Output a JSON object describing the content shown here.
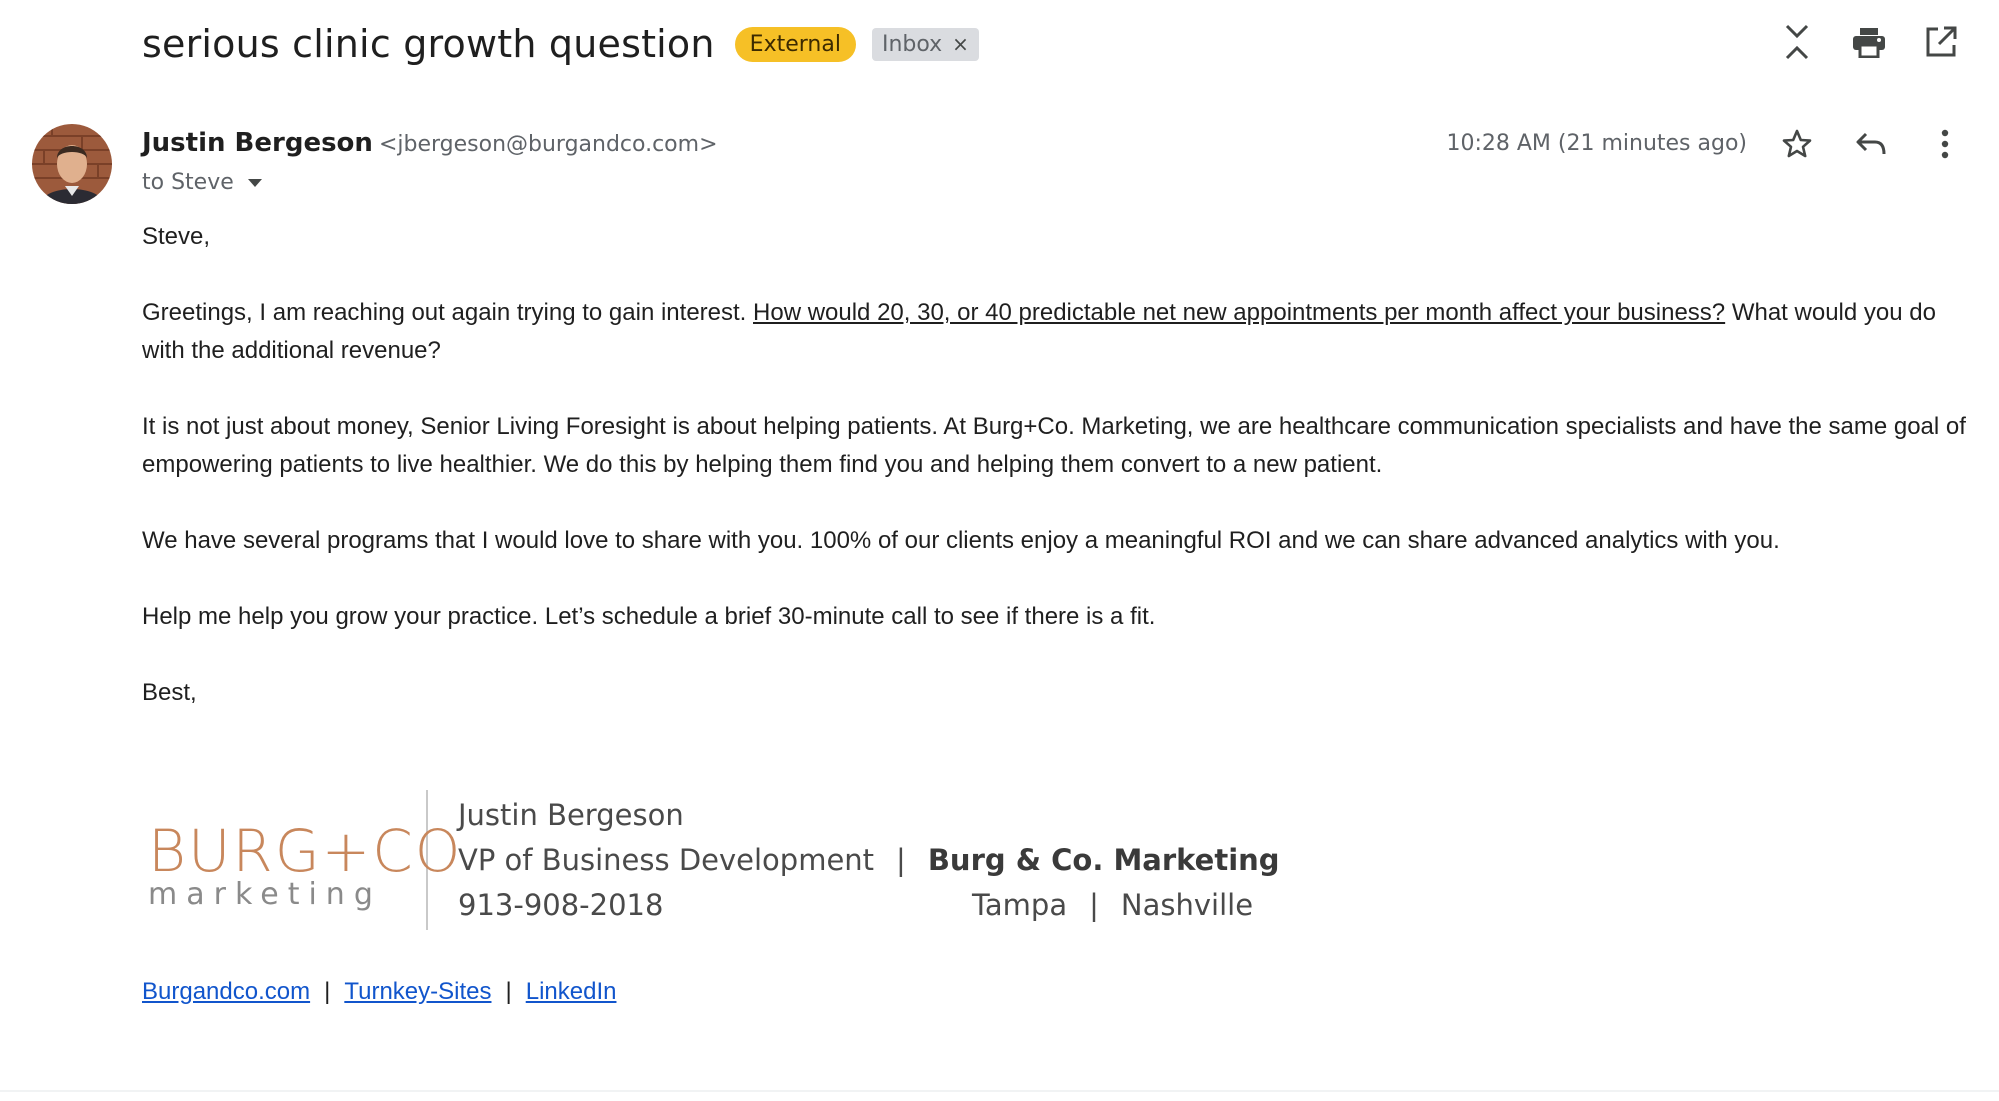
{
  "header": {
    "subject": "serious clinic growth question",
    "labels": {
      "external": "External",
      "inbox": "Inbox",
      "remove": "×"
    },
    "icons": [
      "collapse-all-icon",
      "print-icon",
      "open-in-new-window-icon"
    ]
  },
  "message": {
    "sender_name": "Justin Bergeson",
    "sender_email": "<jbergeson@burgandco.com>",
    "to": "to Steve",
    "timestamp": "10:28 AM (21 minutes ago)",
    "icons": [
      "star-icon",
      "reply-icon",
      "more-vert-icon"
    ]
  },
  "body": {
    "greeting": "Steve,",
    "p1_before": "Greetings, I am reaching out again trying to gain interest. ",
    "p1_link": "How would 20, 30, or 40 predictable net new appointments per month affect your business?",
    "p1_after": " What would you do with the additional revenue?",
    "p2": "It is not just about money, Senior Living Foresight is about helping patients. At Burg+Co. Marketing, we are healthcare communication specialists and have the same goal of empowering patients to live healthier. We do this by helping them find you and helping them convert to a new patient.",
    "p3": "We have several programs that I would love to share with you. 100% of our clients enjoy a meaningful ROI and we can share advanced analytics with you.",
    "p4": "Help me help you grow your practice. Let’s schedule a brief 30-minute call to see if there is a fit.",
    "closing": "Best,"
  },
  "signature": {
    "logo_main": "BURG+CO",
    "logo_sub": "marketing",
    "name": "Justin Bergeson",
    "title": "VP of Business Development",
    "pipe": "|",
    "company": "Burg & Co. Marketing",
    "phone": "913-908-2018",
    "city1": "Tampa",
    "city2": "Nashville"
  },
  "links": {
    "site": "Burgandco.com",
    "turnkey": "Turnkey-Sites",
    "linkedin": "LinkedIn",
    "sep": "|"
  },
  "colors": {
    "external_badge": "#f6c026",
    "inbox_badge": "#dadce0",
    "link": "#1155cc",
    "logo_accent": "#c8875c"
  }
}
